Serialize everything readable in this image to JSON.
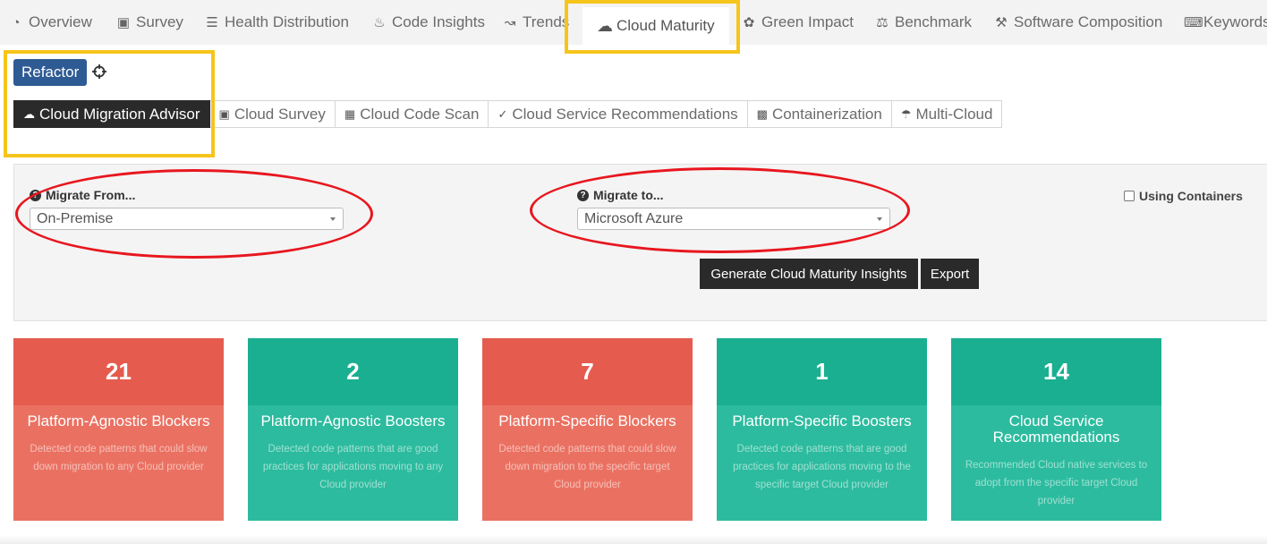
{
  "top_tabs": [
    {
      "label": "Overview",
      "icon": "dashboard-icon"
    },
    {
      "label": "Survey",
      "icon": "briefcase-icon"
    },
    {
      "label": "Health Distribution",
      "icon": "tasks-icon"
    },
    {
      "label": "Code Insights",
      "icon": "fire-icon"
    },
    {
      "label": "Trends",
      "icon": "line-chart-icon"
    },
    {
      "label": "Cloud Maturity",
      "icon": "cloud-icon",
      "active": true
    },
    {
      "label": "Green Impact",
      "icon": "leaf-icon"
    },
    {
      "label": "Benchmark",
      "icon": "flask-icon"
    },
    {
      "label": "Software Composition",
      "icon": "wrench-icon"
    },
    {
      "label": "Keywords",
      "icon": "keyboard-icon"
    }
  ],
  "refactor_label": "Refactor",
  "sub_tabs": [
    {
      "label": "Cloud Migration Advisor",
      "icon": "cloud-upload-icon",
      "active": true
    },
    {
      "label": "Cloud Survey",
      "icon": "briefcase-icon"
    },
    {
      "label": "Cloud Code Scan",
      "icon": "qrcode-icon"
    },
    {
      "label": "Cloud Service Recommendations",
      "icon": "check-circle-icon"
    },
    {
      "label": "Containerization",
      "icon": "cubes-icon"
    },
    {
      "label": "Multi-Cloud",
      "icon": "cloud-rain-icon"
    }
  ],
  "form": {
    "from_label": "Migrate From...",
    "from_value": "On-Premise",
    "to_label": "Migrate to...",
    "to_value": "Microsoft Azure",
    "containers_label": "Using Containers",
    "generate_label": "Generate Cloud Maturity Insights",
    "export_label": "Export"
  },
  "cards": [
    {
      "value": "21",
      "title": "Platform-Agnostic Blockers",
      "desc": "Detected code patterns that could slow down migration to any Cloud provider",
      "color": "#e55c4e"
    },
    {
      "value": "2",
      "title": "Platform-Agnostic Boosters",
      "desc": "Detected code patterns that are good practices for applications moving to any Cloud provider",
      "color": "#1aaf91"
    },
    {
      "value": "7",
      "title": "Platform-Specific Blockers",
      "desc": "Detected code patterns that could slow down migration to the specific target Cloud provider",
      "color": "#e55c4e"
    },
    {
      "value": "1",
      "title": "Platform-Specific Boosters",
      "desc": "Detected code patterns that are good practices for applications moving to the specific target Cloud provider",
      "color": "#1aaf91"
    },
    {
      "value": "14",
      "title": "Cloud Service Recommendations",
      "desc": "Recommended Cloud native services to adopt from the specific target Cloud provider",
      "color": "#1aaf91"
    }
  ]
}
